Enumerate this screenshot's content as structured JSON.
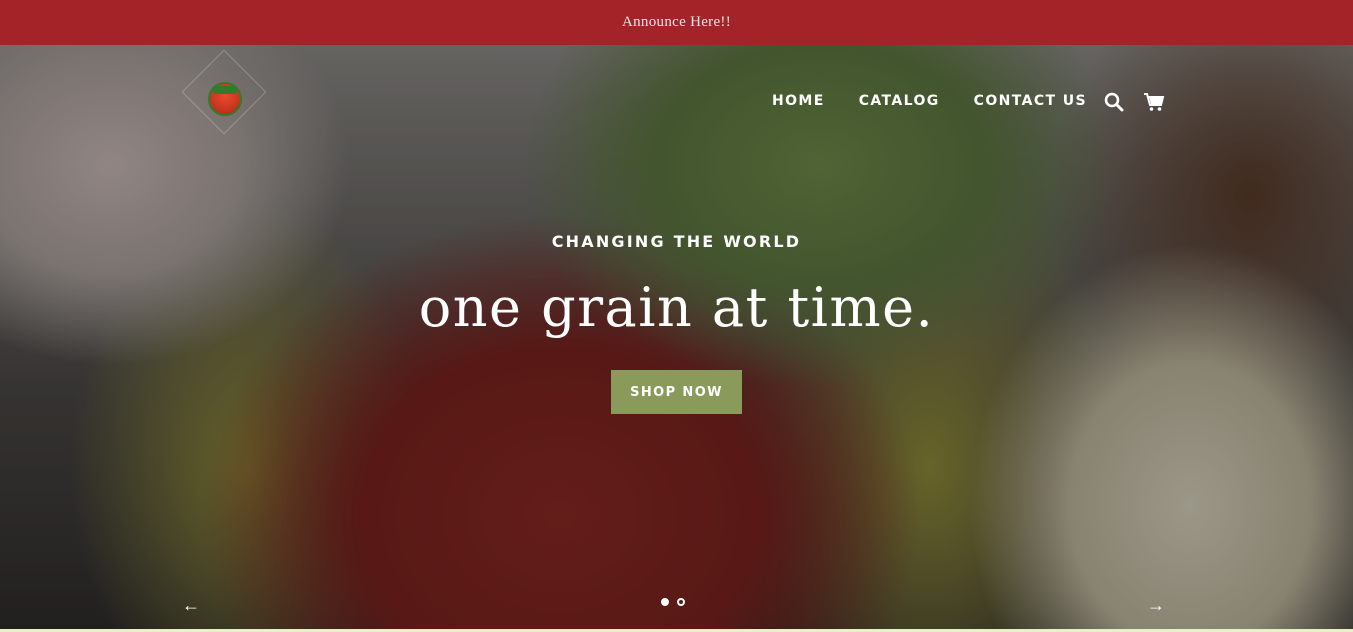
{
  "announcement": {
    "text": "Announce Here!!"
  },
  "header": {
    "logo": {
      "name": "store-logo"
    },
    "nav": [
      {
        "label": "HOME"
      },
      {
        "label": "CATALOG"
      },
      {
        "label": "CONTACT US"
      }
    ],
    "icons": [
      "search-icon",
      "cart-icon"
    ]
  },
  "hero": {
    "eyebrow": "CHANGING THE WORLD",
    "headline": "one grain at time.",
    "cta": "SHOP NOW",
    "slides": {
      "current": 1,
      "total": 2
    },
    "prev_arrow": "←",
    "next_arrow": "→"
  },
  "colors": {
    "announcement_bg": "#a32329",
    "cta_bg": "#8a9a5b",
    "text": "#ffffff"
  }
}
